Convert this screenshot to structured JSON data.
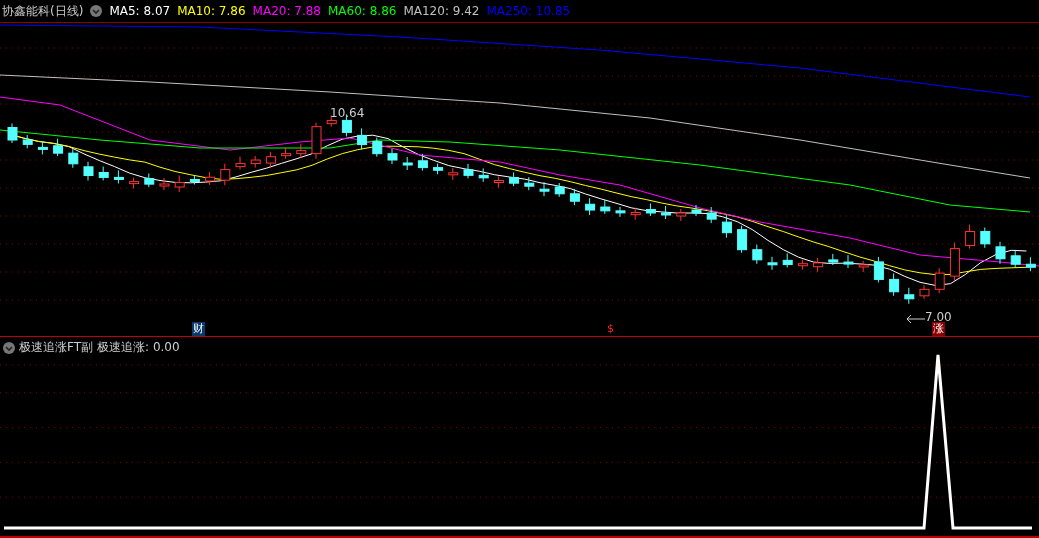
{
  "title": "协鑫能科(日线)",
  "moving_averages": [
    {
      "label": "MA5: 8.07",
      "color": "#ffffff"
    },
    {
      "label": "MA10: 7.86",
      "color": "#ffff00"
    },
    {
      "label": "MA20: 7.88",
      "color": "#ff00ff"
    },
    {
      "label": "MA60: 8.86",
      "color": "#00ff00"
    },
    {
      "label": "MA120: 9.42",
      "color": "#c0c0c0"
    },
    {
      "label": "MA250: 10.85",
      "color": "#0000ff"
    }
  ],
  "price_labels": [
    {
      "text": "10.64",
      "kind": "high"
    },
    {
      "text": "7.00",
      "kind": "low"
    }
  ],
  "event_markers": [
    {
      "text": "财",
      "kind": "finance"
    },
    {
      "text": "$",
      "kind": "dollar"
    },
    {
      "text": "涨",
      "kind": "rise"
    }
  ],
  "indicator": {
    "title": "极速追涨FT副",
    "value": "极速追涨: 0.00"
  }
}
